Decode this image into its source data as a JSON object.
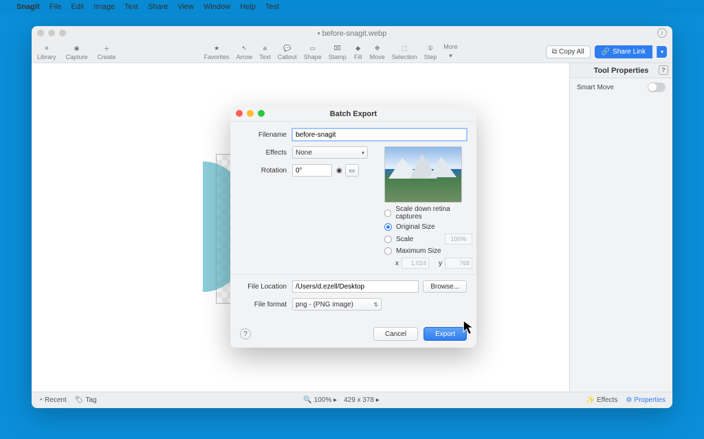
{
  "menubar": {
    "app": "Snagit",
    "items": [
      "File",
      "Edit",
      "Image",
      "Text",
      "Share",
      "View",
      "Window",
      "Help",
      "Test"
    ]
  },
  "window": {
    "title": "• before-snagit.webp"
  },
  "toolbar": {
    "left": [
      {
        "label": "Library",
        "icon": "≡"
      },
      {
        "label": "Capture",
        "icon": "◉"
      },
      {
        "label": "Create",
        "icon": "＋"
      }
    ],
    "center": [
      {
        "label": "Favorites",
        "icon": "★"
      },
      {
        "label": "Arrow",
        "icon": "↖"
      },
      {
        "label": "Text",
        "icon": "a"
      },
      {
        "label": "Callout",
        "icon": "💬"
      },
      {
        "label": "Shape",
        "icon": "▭"
      },
      {
        "label": "Stamp",
        "icon": "⌧"
      },
      {
        "label": "Fill",
        "icon": "◆"
      },
      {
        "label": "Move",
        "icon": "✥"
      },
      {
        "label": "Selection",
        "icon": "⬚"
      },
      {
        "label": "Step",
        "icon": "①"
      },
      {
        "label": "More",
        "icon": "⋯"
      }
    ],
    "copy_all": "Copy All",
    "share": "Share Link"
  },
  "side": {
    "title": "Tool Properties",
    "smart_move": "Smart Move"
  },
  "status": {
    "recent": "Recent",
    "tag": "Tag",
    "zoom": "100% ▸",
    "dims": "429 x 378 ▸",
    "effects": "Effects",
    "properties": "Properties"
  },
  "dialog": {
    "title": "Batch Export",
    "filename_label": "Filename",
    "filename_value": "before-snagit",
    "effects_label": "Effects",
    "effects_value": "None",
    "rotation_label": "Rotation",
    "rotation_value": "0°",
    "scale_retina": "Scale down retina captures",
    "original_size": "Original Size",
    "scale": "Scale",
    "scale_pct": "100%",
    "max_size": "Maximum Size",
    "dim_x_label": "x",
    "dim_x": "1,024",
    "dim_y_label": "y",
    "dim_y": "768",
    "file_location_label": "File Location",
    "file_location_value": "/Users/d.ezell/Desktop",
    "browse": "Browse...",
    "file_format_label": "File format",
    "file_format_value": "png - (PNG image)",
    "cancel": "Cancel",
    "export": "Export"
  }
}
